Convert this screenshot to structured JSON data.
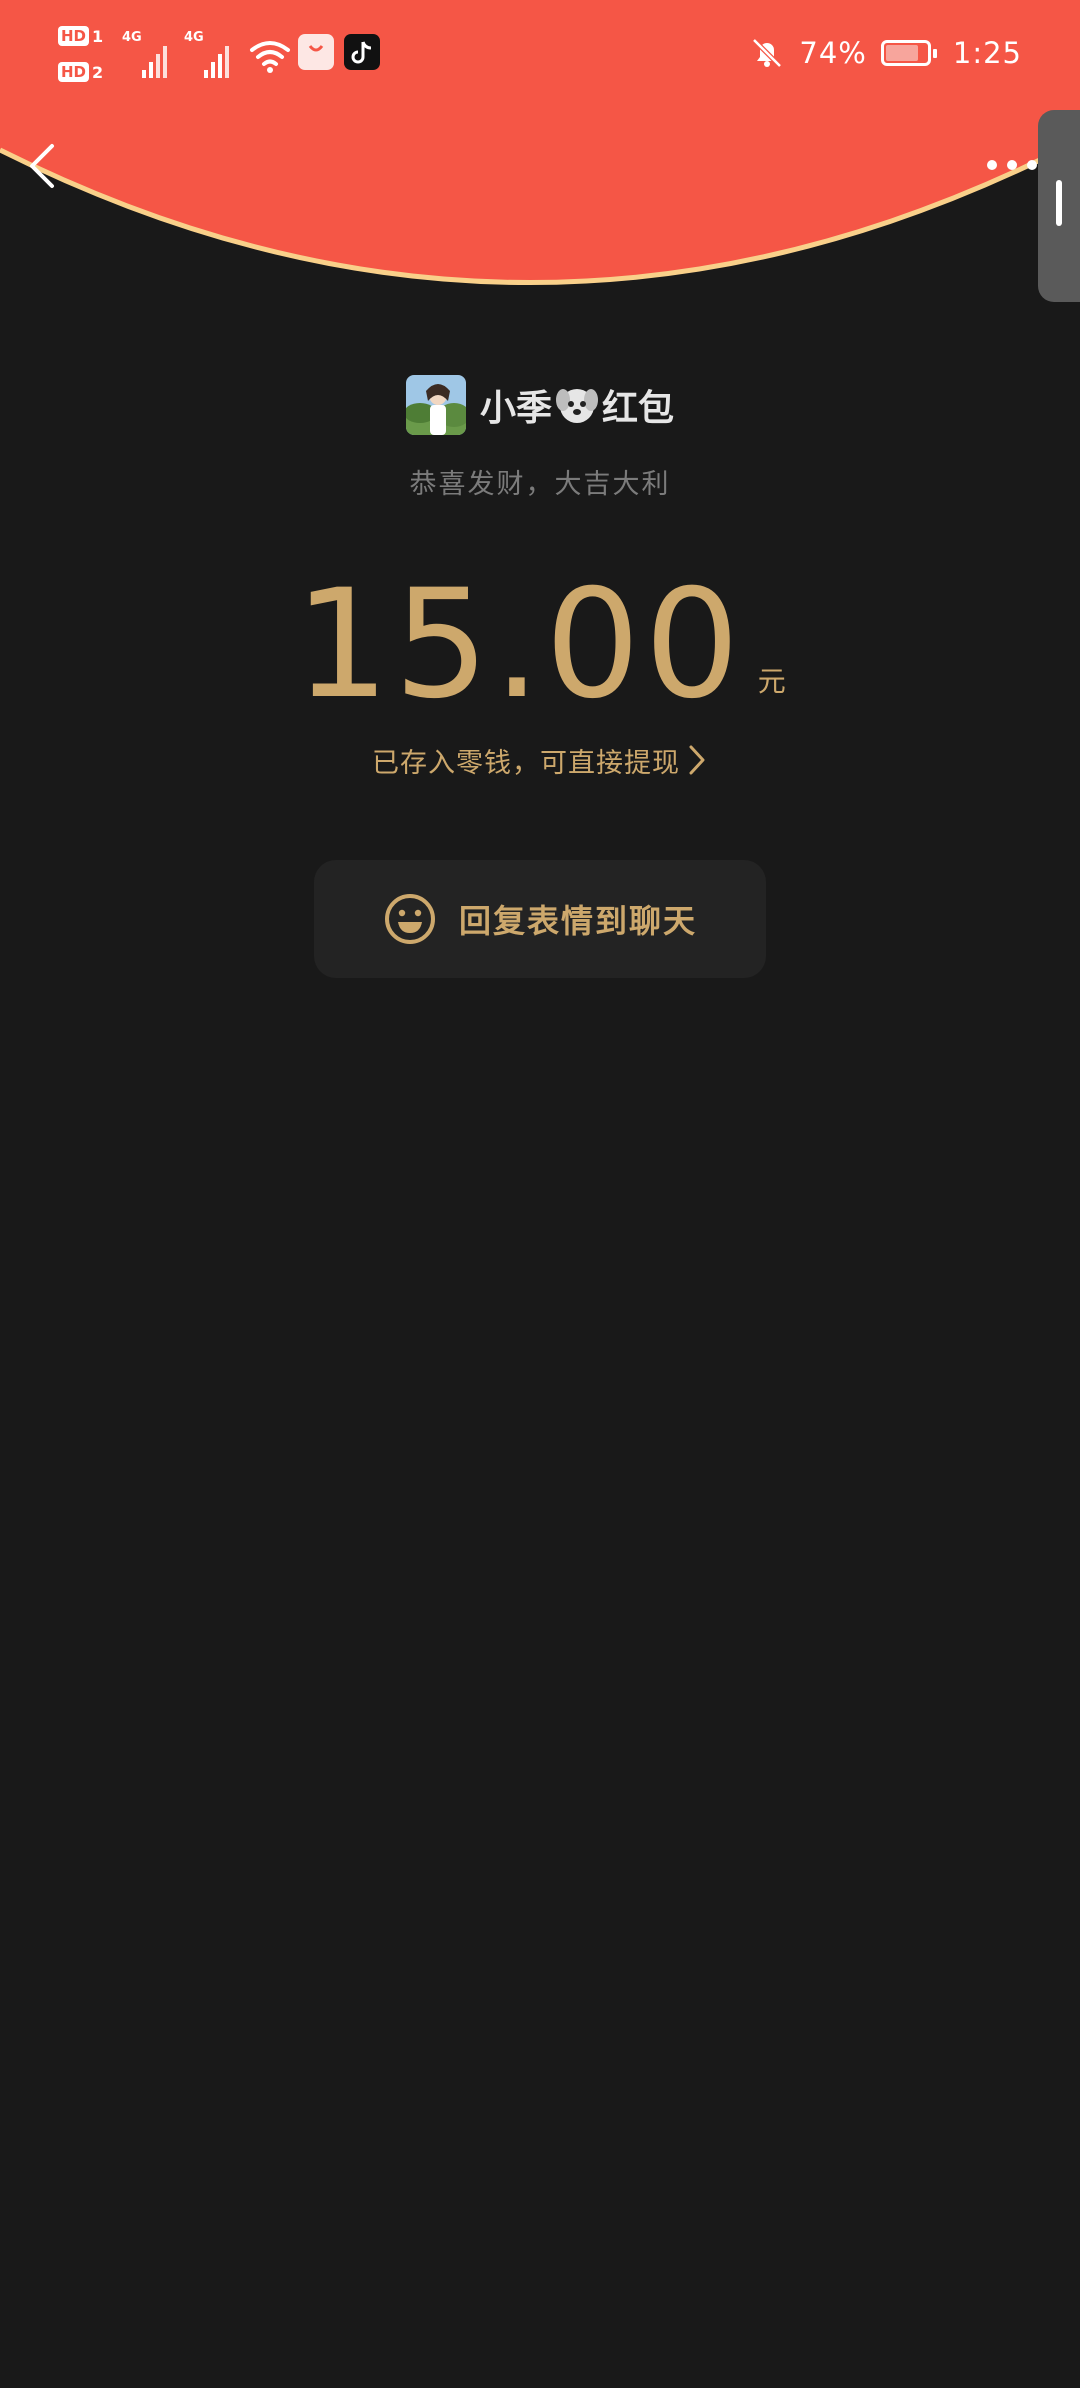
{
  "status_bar": {
    "sim1_badge": "HD",
    "sim1_num": "1",
    "sim2_badge": "HD",
    "sim2_num": "2",
    "net1": "4G",
    "net2": "4G",
    "battery_percent": "74%",
    "time": "1:25"
  },
  "header": {
    "background_color": "#F55646",
    "curve_border_color": "#F9D08A"
  },
  "red_packet": {
    "sender_title": "小季",
    "sender_suffix": "红包",
    "blessing": "恭喜发财，大吉大利",
    "amount": "15.00",
    "unit": "元",
    "saved_text": "已存入零钱，可直接提现",
    "reply_button_label": "回复表情到聊天"
  },
  "colors": {
    "background": "#191919",
    "gold": "#CDA86C",
    "button_bg": "#232323"
  }
}
